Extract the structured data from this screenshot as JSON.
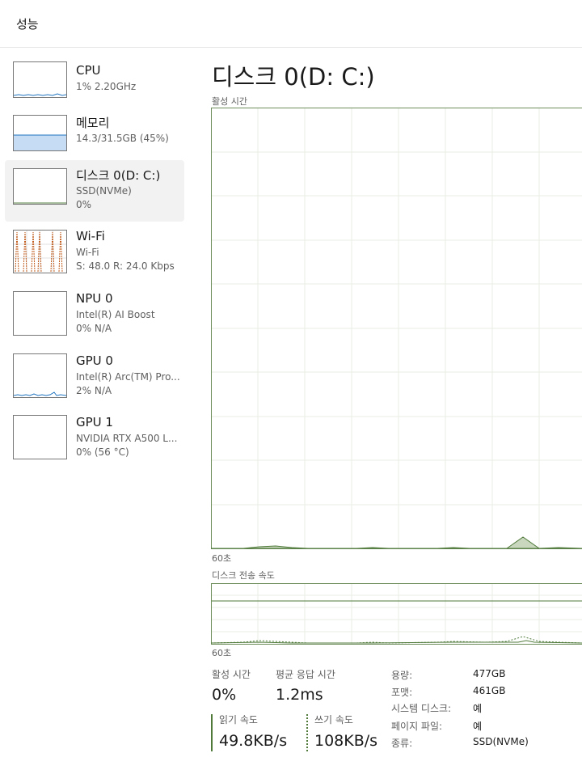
{
  "header": {
    "title": "성능"
  },
  "sidebar": {
    "items": [
      {
        "name": "CPU",
        "line1": "1% 2.20GHz",
        "line2": ""
      },
      {
        "name": "메모리",
        "line1": "14.3/31.5GB (45%)",
        "line2": ""
      },
      {
        "name": "디스크 0(D: C:)",
        "line1": "SSD(NVMe)",
        "line2": "0%"
      },
      {
        "name": "Wi-Fi",
        "line1": "Wi-Fi",
        "line2": "S: 48.0 R: 24.0 Kbps"
      },
      {
        "name": "NPU 0",
        "line1": "Intel(R) AI Boost",
        "line2": "0% N/A"
      },
      {
        "name": "GPU 0",
        "line1": "Intel(R) Arc(TM) Pro...",
        "line2": "2% N/A"
      },
      {
        "name": "GPU 1",
        "line1": "NVIDIA RTX A500 L...",
        "line2": "0% (56 °C)"
      }
    ]
  },
  "main": {
    "title": "디스크 0(D: C:)",
    "activity_chart": {
      "label": "활성 시간",
      "time_label": "60초",
      "color": "#4f7a3a",
      "fill": "#c8d7bd"
    },
    "transfer_chart": {
      "label": "디스크 전송 속도",
      "time_label": "60초"
    },
    "stats": {
      "active_time_label": "활성 시간",
      "active_time_value": "0%",
      "avg_response_label": "평균 응답 시간",
      "avg_response_value": "1.2ms",
      "read_speed_label": "읽기 속도",
      "read_speed_value": "49.8KB/s",
      "write_speed_label": "쓰기 속도",
      "write_speed_value": "108KB/s"
    },
    "properties": [
      {
        "label": "용량:",
        "value": "477GB"
      },
      {
        "label": "포맷:",
        "value": "461GB"
      },
      {
        "label": "시스템 디스크:",
        "value": "예"
      },
      {
        "label": "페이지 파일:",
        "value": "예"
      },
      {
        "label": "종류:",
        "value": "SSD(NVMe)"
      }
    ]
  }
}
